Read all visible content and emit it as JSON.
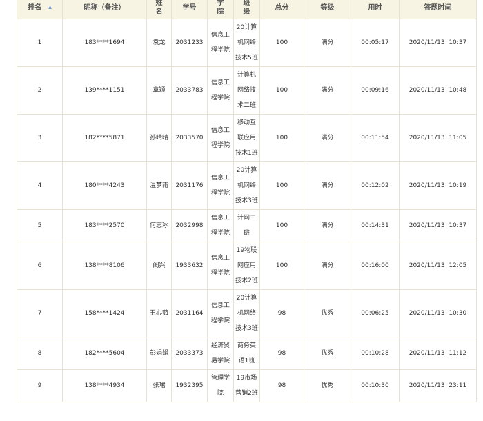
{
  "headers": {
    "rank": "排名",
    "nickname": "昵称（备注）",
    "name": "姓\n名",
    "student_id": "学号",
    "college": "学\n院",
    "class": "班\n级",
    "score": "总分",
    "grade": "等级",
    "duration": "用时",
    "submit_time": "答题时间"
  },
  "rows": [
    {
      "rank": "1",
      "nickname": "183****1694",
      "name": "袁龙",
      "student_id": "2031233",
      "college": "信息工程学院",
      "class": "20计算机网络技术5班",
      "score": "100",
      "grade": "满分",
      "duration": "00:05:17",
      "submit_time": "2020/11/13  10:37"
    },
    {
      "rank": "2",
      "nickname": "139****1151",
      "name": "章颖",
      "student_id": "2033783",
      "college": "信息工程学院",
      "class": "计算机网络技术二班",
      "score": "100",
      "grade": "满分",
      "duration": "00:09:16",
      "submit_time": "2020/11/13  10:48"
    },
    {
      "rank": "3",
      "nickname": "182****5871",
      "name": "孙晴晴",
      "student_id": "2033570",
      "college": "信息工程学院",
      "class": "移动互联应用技术1班",
      "score": "100",
      "grade": "满分",
      "duration": "00:11:54",
      "submit_time": "2020/11/13  11:05"
    },
    {
      "rank": "4",
      "nickname": "180****4243",
      "name": "温梦雨",
      "student_id": "2031176",
      "college": "信息工程学院",
      "class": "20计算机网络技术3班",
      "score": "100",
      "grade": "满分",
      "duration": "00:12:02",
      "submit_time": "2020/11/13  10:19"
    },
    {
      "rank": "5",
      "nickname": "183****2570",
      "name": "何志冰",
      "student_id": "2032998",
      "college": "信息工程学院",
      "class": "计网二班",
      "score": "100",
      "grade": "满分",
      "duration": "00:14:31",
      "submit_time": "2020/11/13  10:37"
    },
    {
      "rank": "6",
      "nickname": "138****8106",
      "name": "阚兴",
      "student_id": "1933632",
      "college": "信息工程学院",
      "class": "19物联网应用技术2班",
      "score": "100",
      "grade": "满分",
      "duration": "00:16:00",
      "submit_time": "2020/11/13  12:05"
    },
    {
      "rank": "7",
      "nickname": "158****1424",
      "name": "王心茹",
      "student_id": "2031164",
      "college": "信息工程学院",
      "class": "20计算机网络技术3班",
      "score": "98",
      "grade": "优秀",
      "duration": "00:06:25",
      "submit_time": "2020/11/13  10:30"
    },
    {
      "rank": "8",
      "nickname": "182****5604",
      "name": "彭娟娟",
      "student_id": "2033373",
      "college": "经济贸易学院",
      "class": "商务英语1班",
      "score": "98",
      "grade": "优秀",
      "duration": "00:10:28",
      "submit_time": "2020/11/13  11:12"
    },
    {
      "rank": "9",
      "nickname": "138****4934",
      "name": "张珺",
      "student_id": "1932395",
      "college": "管理学院",
      "class": "19市场营销2班",
      "score": "98",
      "grade": "优秀",
      "duration": "00:10:30",
      "submit_time": "2020/11/13  23:11"
    }
  ],
  "icons": {
    "sort": "sort-up-icon"
  },
  "colors": {
    "header_bg": "#f7f4e3",
    "border": "#e6e2d3",
    "sort_icon": "#5a84c8"
  }
}
